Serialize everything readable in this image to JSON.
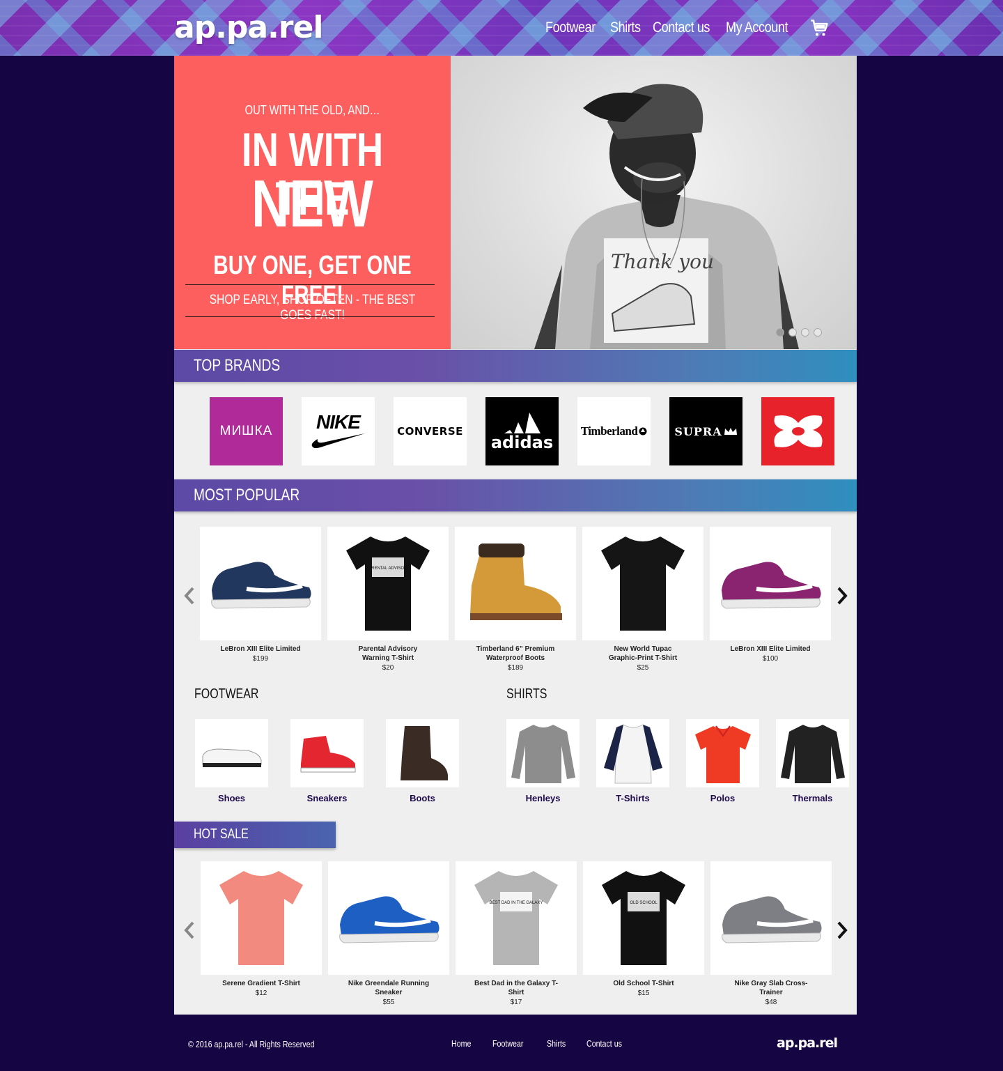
{
  "header": {
    "logo": "ap.pa.rel",
    "nav": [
      "Footwear",
      "Shirts",
      "Contact us",
      "My Account"
    ]
  },
  "hero": {
    "kicker": "OUT WITH THE OLD, AND…",
    "line1": "IN WITH THE",
    "line2": "NEW",
    "offer": "BUY ONE, GET ONE FREE!",
    "tagline": "SHOP EARLY, SHOP OFTEN - THE BEST GOES FAST!",
    "slide_count": 4,
    "active_slide": 1,
    "shirt_print": "Thank you"
  },
  "top_brands": {
    "title": "TOP BRANDS",
    "brands": [
      {
        "name": "МИШКА",
        "bg": "#b02a9a",
        "fg": "#ffffff"
      },
      {
        "name": "NIKE",
        "bg": "#ffffff",
        "fg": "#000000"
      },
      {
        "name": "CONVERSE",
        "bg": "#ffffff",
        "fg": "#000000"
      },
      {
        "name": "adidas",
        "bg": "#000000",
        "fg": "#ffffff"
      },
      {
        "name": "Timberland",
        "bg": "#ffffff",
        "fg": "#000000"
      },
      {
        "name": "SUPRA",
        "bg": "#000000",
        "fg": "#ffffff"
      },
      {
        "name": "Under Armour",
        "bg": "#e8222a",
        "fg": "#ffffff"
      }
    ]
  },
  "most_popular": {
    "title": "MOST POPULAR",
    "items": [
      {
        "name": "LeBron XIII Elite Limited",
        "price": "$199",
        "icon": "sneaker-icon",
        "color": "#22375e"
      },
      {
        "name": "Parental Advisory Warning T-Shirt",
        "price": "$20",
        "icon": "tshirt-icon",
        "color": "#111111",
        "print": "PARENTAL ADVISORY"
      },
      {
        "name": "Timberland 6” Premium Waterproof Boots",
        "price": "$189",
        "icon": "boot-icon",
        "color": "#d49a3a"
      },
      {
        "name": "New World Tupac Graphic-Print T-Shirt",
        "price": "$25",
        "icon": "tshirt-icon",
        "color": "#151515"
      },
      {
        "name": "LeBron XIII Elite Limited",
        "price": "$100",
        "icon": "sneaker-icon",
        "color": "#8b2470"
      }
    ]
  },
  "footwear": {
    "title": "FOOTWEAR",
    "items": [
      {
        "label": "Shoes",
        "color": "#f5f5f5"
      },
      {
        "label": "Sneakers",
        "color": "#e32630"
      },
      {
        "label": "Boots",
        "color": "#3a2c24"
      }
    ]
  },
  "shirts": {
    "title": "SHIRTS",
    "items": [
      {
        "label": "Henleys",
        "color": "#8d8d8d"
      },
      {
        "label": "T-Shirts",
        "color": "#1b2347"
      },
      {
        "label": "Polos",
        "color": "#ef3b24"
      },
      {
        "label": "Thermals",
        "color": "#222222"
      }
    ]
  },
  "hot_sale": {
    "title": "HOT SALE",
    "items": [
      {
        "name": "Serene Gradient T-Shirt",
        "price": "$12",
        "icon": "tshirt-icon",
        "color": "#f28a80"
      },
      {
        "name": "Nike Greendale Running Sneaker",
        "price": "$55",
        "icon": "sneaker-icon",
        "color": "#1d5fc2"
      },
      {
        "name": "Best Dad in the Galaxy T-Shirt",
        "price": "$17",
        "icon": "tshirt-icon",
        "color": "#b5b5b5",
        "print": "BEST DAD IN THE GALAXY"
      },
      {
        "name": "Old School T-Shirt",
        "price": "$15",
        "icon": "tshirt-icon",
        "color": "#111111",
        "print": "OLD SCHOOL"
      },
      {
        "name": "Nike Gray Slab Cross-Trainer",
        "price": "$48",
        "icon": "sneaker-icon",
        "color": "#7d7f84"
      }
    ]
  },
  "footer": {
    "copyright": "© 2016 ap.pa.rel - All Rights Reserved",
    "links": [
      "Home",
      "Footwear",
      "Shirts",
      "Contact us"
    ],
    "logo": "ap.pa.rel"
  }
}
